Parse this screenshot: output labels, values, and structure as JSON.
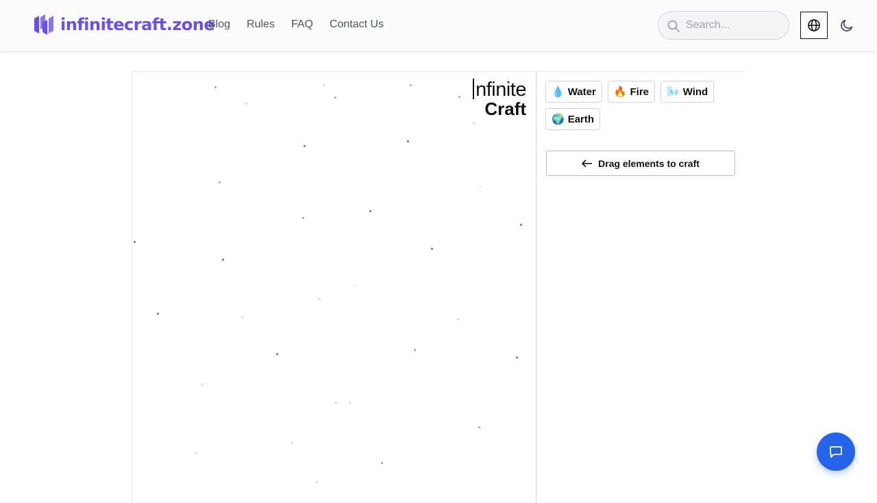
{
  "site": {
    "brand_name": "infinitecraft.zone",
    "brand_color": "#6a4ff0"
  },
  "nav": {
    "links": [
      {
        "label": "Blog"
      },
      {
        "label": "Rules"
      },
      {
        "label": "FAQ"
      },
      {
        "label": "Contact Us"
      }
    ]
  },
  "search": {
    "placeholder": "Search...",
    "value": ""
  },
  "icons": {
    "search": "search-icon",
    "language": "globe-icon",
    "theme": "moon-icon",
    "chat": "chat-icon",
    "drag": "arrow-left-icon"
  },
  "game": {
    "logo_line1": "nfinite",
    "logo_line2": "Craft",
    "elements": [
      {
        "emoji": "💧",
        "name": "Water"
      },
      {
        "emoji": "🔥",
        "name": "Fire"
      },
      {
        "emoji": "🌬️",
        "name": "Wind"
      },
      {
        "emoji": "🌍",
        "name": "Earth"
      }
    ],
    "drag_hint": "Drag elements to craft"
  },
  "colors": {
    "accent": "#2563eb",
    "text": "#4b5563"
  }
}
